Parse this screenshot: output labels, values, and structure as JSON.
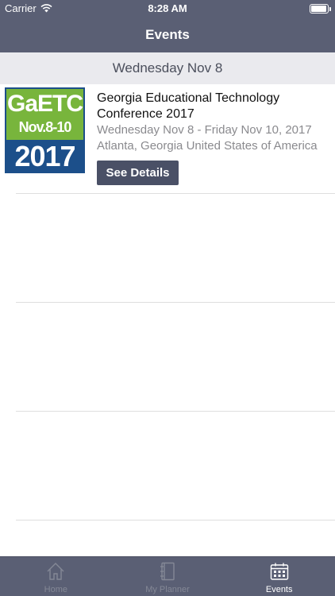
{
  "status_bar": {
    "carrier": "Carrier",
    "time": "8:28 AM"
  },
  "nav": {
    "title": "Events"
  },
  "section": {
    "header": "Wednesday Nov 8"
  },
  "event": {
    "logo": {
      "line1": "GaETC",
      "line2": "Nov.8-10",
      "line3": "2017"
    },
    "title": "Georgia Educational Technology Conference 2017",
    "dates": "Wednesday Nov 8 - Friday Nov 10, 2017",
    "location": "Atlanta, Georgia United States of America",
    "button_label": "See Details"
  },
  "tabs": [
    {
      "label": "Home",
      "icon": "home-icon",
      "active": false
    },
    {
      "label": "My Planner",
      "icon": "planner-icon",
      "active": false
    },
    {
      "label": "Events",
      "icon": "calendar-icon",
      "active": true
    }
  ],
  "colors": {
    "bar": "#5a5f74",
    "button": "#4a5066",
    "logo_green": "#78b53c",
    "logo_blue": "#1c4f8a"
  }
}
